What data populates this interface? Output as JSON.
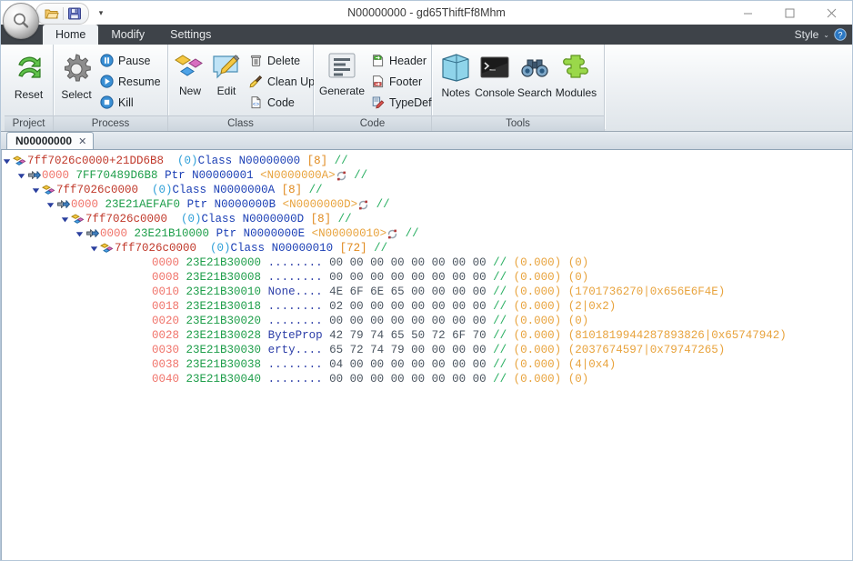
{
  "window": {
    "title": "N00000000 - gd65ThiftFf8Mhm",
    "minimize_label": "—",
    "maximize_label": "☐",
    "close_label": "✕",
    "app_button": "app-orb"
  },
  "quick_access": {
    "open_label": "Open",
    "save_label": "Save",
    "more_label": "▾"
  },
  "ribbon_tabs": [
    {
      "label": "Home",
      "active": true
    },
    {
      "label": "Modify",
      "active": false
    },
    {
      "label": "Settings",
      "active": false
    }
  ],
  "style_menu": {
    "label": "Style",
    "chevron": "⌄",
    "help_label": "?"
  },
  "ribbon_groups": [
    {
      "title": "Project",
      "big": [
        {
          "label": "Reset",
          "icon": "reset-icon"
        }
      ],
      "small": []
    },
    {
      "title": "Process",
      "big": [
        {
          "label": "Select",
          "icon": "gear-icon"
        }
      ],
      "small": [
        {
          "label": "Pause",
          "icon": "pause-icon"
        },
        {
          "label": "Resume",
          "icon": "play-icon"
        },
        {
          "label": "Kill",
          "icon": "stop-icon"
        }
      ]
    },
    {
      "title": "Class",
      "big": [
        {
          "label": "New",
          "icon": "new-shapes-icon"
        },
        {
          "label": "Edit",
          "icon": "edit-pencil-icon"
        }
      ],
      "small": [
        {
          "label": "Delete",
          "icon": "trash-icon"
        },
        {
          "label": "Clean Up",
          "icon": "broom-icon"
        },
        {
          "label": "Code",
          "icon": "code-file-icon"
        }
      ]
    },
    {
      "title": "Code",
      "big": [
        {
          "label": "Generate",
          "icon": "generate-lines-icon"
        }
      ],
      "small": [
        {
          "label": "Header",
          "icon": "header-file-icon"
        },
        {
          "label": "Footer",
          "icon": "footer-file-icon"
        },
        {
          "label": "TypeDef",
          "icon": "typedef-icon"
        }
      ]
    },
    {
      "title": "Tools",
      "big": [
        {
          "label": "Notes",
          "icon": "notes-icon"
        },
        {
          "label": "Console",
          "icon": "console-icon"
        },
        {
          "label": "Search",
          "icon": "binoculars-icon"
        },
        {
          "label": "Modules",
          "icon": "puzzle-icon"
        }
      ],
      "small": []
    }
  ],
  "doc_tabs": [
    {
      "label": "N00000000",
      "close": "✕",
      "active": true
    }
  ],
  "tree": {
    "rows": [
      {
        "kind": "class",
        "indent": 0,
        "arrow": "▼",
        "icon": "class-node-icon",
        "address": "7ff7026c0000+21DD6B8",
        "index": "(0)",
        "keyword": "Class",
        "name": "N00000000",
        "size": "[8]",
        "comment": "//"
      },
      {
        "kind": "ptr",
        "indent": 1,
        "arrow": "▼",
        "icon": "pointer-node-icon",
        "offset": "0000",
        "address": "7FF70489D6B8",
        "keyword": "Ptr",
        "name": "N00000001",
        "type": "<N0000000A>",
        "refresh": "refresh-icon",
        "comment": "//"
      },
      {
        "kind": "class",
        "indent": 2,
        "arrow": "▼",
        "icon": "class-node-icon",
        "address": "7ff7026c0000",
        "index": "(0)",
        "keyword": "Class",
        "name": "N0000000A",
        "size": "[8]",
        "comment": "//"
      },
      {
        "kind": "ptr",
        "indent": 3,
        "arrow": "▼",
        "icon": "pointer-node-icon",
        "offset": "0000",
        "address": "23E21AEFAF0",
        "keyword": "Ptr",
        "name": "N0000000B",
        "type": "<N0000000D>",
        "refresh": "refresh-icon",
        "comment": "//"
      },
      {
        "kind": "class",
        "indent": 4,
        "arrow": "▼",
        "icon": "class-node-icon",
        "address": "7ff7026c0000",
        "index": "(0)",
        "keyword": "Class",
        "name": "N0000000D",
        "size": "[8]",
        "comment": "//"
      },
      {
        "kind": "ptr",
        "indent": 5,
        "arrow": "▼",
        "icon": "pointer-node-icon",
        "offset": "0000",
        "address": "23E21B10000",
        "keyword": "Ptr",
        "name": "N0000000E",
        "type": "<N00000010>",
        "refresh": "refresh-icon",
        "comment": "//"
      },
      {
        "kind": "class",
        "indent": 6,
        "arrow": "▼",
        "icon": "class-node-icon",
        "address": "7ff7026c0000",
        "index": "(0)",
        "keyword": "Class",
        "name": "N00000010",
        "size": "[72]",
        "comment": "//"
      }
    ],
    "hex_rows": [
      {
        "offset": "0000",
        "address": "23E21B30000",
        "ascii": "........",
        "bytes": "00 00 00 00 00 00 00 00",
        "comment": "//",
        "float_value": "(0.000)",
        "int_value": "(0)"
      },
      {
        "offset": "0008",
        "address": "23E21B30008",
        "ascii": "........",
        "bytes": "00 00 00 00 00 00 00 00",
        "comment": "//",
        "float_value": "(0.000)",
        "int_value": "(0)"
      },
      {
        "offset": "0010",
        "address": "23E21B30010",
        "ascii": "None....",
        "bytes": "4E 6F 6E 65 00 00 00 00",
        "comment": "//",
        "float_value": "(0.000)",
        "int_value": "(1701736270|0x656E6F4E)"
      },
      {
        "offset": "0018",
        "address": "23E21B30018",
        "ascii": "........",
        "bytes": "02 00 00 00 00 00 00 00",
        "comment": "//",
        "float_value": "(0.000)",
        "int_value": "(2|0x2)"
      },
      {
        "offset": "0020",
        "address": "23E21B30020",
        "ascii": "........",
        "bytes": "00 00 00 00 00 00 00 00",
        "comment": "//",
        "float_value": "(0.000)",
        "int_value": "(0)"
      },
      {
        "offset": "0028",
        "address": "23E21B30028",
        "ascii": "ByteProp",
        "bytes": "42 79 74 65 50 72 6F 70",
        "comment": "//",
        "float_value": "(0.000)",
        "int_value": "(8101819944287893826|0x65747942)"
      },
      {
        "offset": "0030",
        "address": "23E21B30030",
        "ascii": "erty....",
        "bytes": "65 72 74 79 00 00 00 00",
        "comment": "//",
        "float_value": "(0.000)",
        "int_value": "(2037674597|0x79747265)"
      },
      {
        "offset": "0038",
        "address": "23E21B30038",
        "ascii": "........",
        "bytes": "04 00 00 00 00 00 00 00",
        "comment": "//",
        "float_value": "(0.000)",
        "int_value": "(4|0x4)"
      },
      {
        "offset": "0040",
        "address": "23E21B30040",
        "ascii": "........",
        "bytes": "00 00 00 00 00 00 00 00",
        "comment": "//",
        "float_value": "(0.000)",
        "int_value": "(0)"
      }
    ]
  },
  "colors": {
    "tab_strip_bg": "#3e4349",
    "ribbon_bg": "#eef1f4",
    "address_red": "#c0392b",
    "pointer_green": "#1e9e4a",
    "keyword_blue": "#1b3fb5",
    "size_orange": "#e08a1e",
    "comment_green": "#27ae60"
  }
}
